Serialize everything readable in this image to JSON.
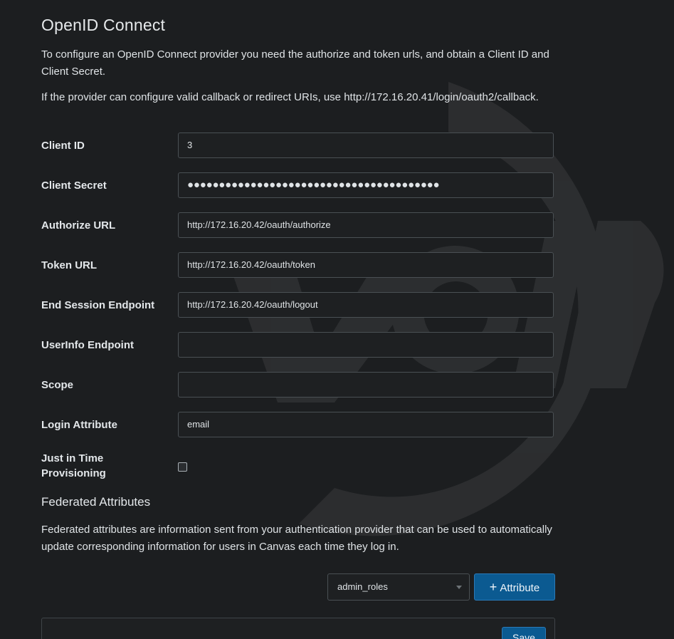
{
  "section": {
    "title": "OpenID Connect",
    "intro": "To configure an OpenID Connect provider you need the authorize and token urls, and obtain a Client ID and Client Secret.",
    "callback_note": "If the provider can configure valid callback or redirect URIs, use http://172.16.20.41/login/oauth2/callback."
  },
  "fields": {
    "client_id": {
      "label": "Client ID",
      "value": "3"
    },
    "client_secret": {
      "label": "Client Secret",
      "value": "●●●●●●●●●●●●●●●●●●●●●●●●●●●●●●●●●●●●●●●●"
    },
    "authorize_url": {
      "label": "Authorize URL",
      "value": "http://172.16.20.42/oauth/authorize"
    },
    "token_url": {
      "label": "Token URL",
      "value": "http://172.16.20.42/oauth/token"
    },
    "end_session": {
      "label": "End Session Endpoint",
      "value": "http://172.16.20.42/oauth/logout"
    },
    "userinfo": {
      "label": "UserInfo Endpoint",
      "value": ""
    },
    "scope": {
      "label": "Scope",
      "value": ""
    },
    "login_attribute": {
      "label": "Login Attribute",
      "value": "email"
    },
    "jit": {
      "label": "Just in Time Provisioning",
      "checked": false
    }
  },
  "federated": {
    "title": "Federated Attributes",
    "description": "Federated attributes are information sent from your authentication provider that can be used to automatically update corresponding information for users in Canvas each time they log in.",
    "selected_attribute": "admin_roles",
    "add_label": "Attribute"
  },
  "save_label": "Save",
  "colors": {
    "background": "#1c1e20",
    "primary_button": "#0b5a91"
  }
}
